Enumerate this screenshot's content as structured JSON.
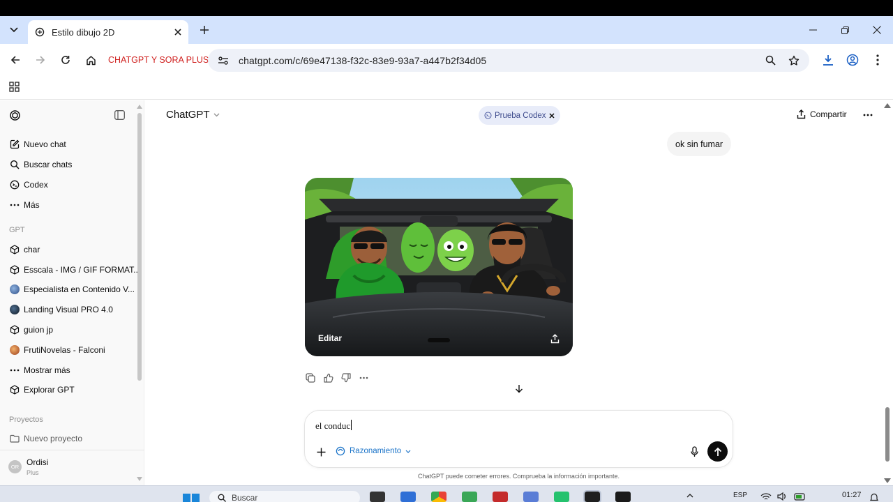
{
  "browser": {
    "tab": {
      "title": "Estilo dibujo 2D"
    },
    "bookmark": {
      "label": "CHATGPT Y SORA PLUS"
    },
    "address": {
      "url": "chatgpt.com/c/69e47138-f32c-83e9-93a7-a447b2f34d05"
    }
  },
  "sidebar": {
    "items": [
      {
        "label": "Nuevo chat",
        "icon": "edit-icon"
      },
      {
        "label": "Buscar chats",
        "icon": "search-icon"
      },
      {
        "label": "Codex",
        "icon": "codex-icon"
      },
      {
        "label": "Más",
        "icon": "more-icon"
      }
    ],
    "gpt_heading": "GPT",
    "gpts": [
      {
        "label": "char",
        "icon": "cube-icon"
      },
      {
        "label": "Esscala - IMG / GIF FORMAT...",
        "icon": "cube-icon"
      },
      {
        "label": "Especialista en Contenido V...",
        "icon": "avatar-globe",
        "color": "#4a6fa5"
      },
      {
        "label": "Landing Visual PRO 4.0",
        "icon": "avatar-dark",
        "color": "#1c2a3a"
      },
      {
        "label": "guion jp",
        "icon": "cube-icon"
      },
      {
        "label": "FrutiNovelas - Falconi",
        "icon": "avatar-fruit",
        "color": "#c0622d"
      },
      {
        "label": "Mostrar más",
        "icon": "more-icon"
      },
      {
        "label": "Explorar GPT",
        "icon": "cube-icon"
      }
    ],
    "projects_heading": "Proyectos",
    "new_project": "Nuevo proyecto",
    "user": {
      "name": "Ordisi",
      "plan": "Plus",
      "initials": "OR"
    }
  },
  "header": {
    "model": "ChatGPT",
    "pill": "Prueba Codex",
    "share": "Compartir"
  },
  "conversation": {
    "user_message": "ok sin fumar",
    "image": {
      "edit_label": "Editar"
    }
  },
  "composer": {
    "value": "el conduc",
    "mode": "Razonamiento",
    "disclaimer": "ChatGPT puede cometer errores. Comprueba la información importante."
  },
  "taskbar": {
    "search": "Buscar",
    "lang": "ESP",
    "time": "01:27"
  },
  "colors": {
    "accent_blue": "#1a73c8",
    "bookmark_red": "#d0211f",
    "tab_strip": "#d3e3fd"
  }
}
